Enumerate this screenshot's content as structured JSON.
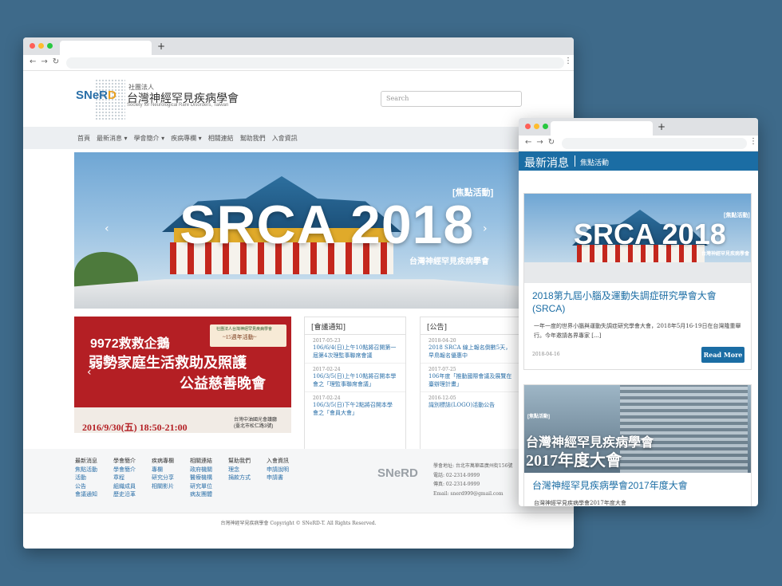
{
  "desktop": {
    "logo": {
      "mark_left": "SNeR",
      "mark_star": "D",
      "sub": "社團法人",
      "name": "台灣神經罕見疾病學會",
      "english": "Society for Neurological Rare Disorders, Taiwan"
    },
    "search_placeholder": "Search",
    "menu": [
      "首頁",
      "最新消息 ▾",
      "學會簡介 ▾",
      "疾病專欄 ▾",
      "相關連結",
      "幫助我們",
      "入會資訊"
    ],
    "banner": {
      "tag": "[焦點活動]",
      "title": "SRCA 2018",
      "subtitle": "台灣神經罕見疾病學會"
    },
    "promo": {
      "line1": "9972救救企鵝",
      "line2": "弱勢家庭生活救助及照護",
      "line3": "公益慈善晚會",
      "badge1": "社團法人台灣神經罕見疾病學會",
      "badge2": "~15週年活動~",
      "date": "2016/9/30(五) 18:50-21:00",
      "venue1": "台灣中油國光會議廳",
      "venue2": "(臺北市松仁路3號)"
    },
    "meetings": {
      "heading": "[會議通知]",
      "items": [
        {
          "date": "2017-05-23",
          "title": "106/6/4(日)上午10點將召開第一屆第4次理監事聯席會議"
        },
        {
          "date": "2017-02-24",
          "title": "106/3/5(日)上午10點將召開本學會之「理監事聯席會議」"
        },
        {
          "date": "2017-02-24",
          "title": "106/3/5(日)下午2點將召開本學會之「會員大會」"
        }
      ]
    },
    "announcements": {
      "heading": "[公告]",
      "items": [
        {
          "date": "2018-04-20",
          "title": "2018 SRCA 線上報名倒數5天，早鳥報名優惠中"
        },
        {
          "date": "2017-07-25",
          "title": "106年度「推動國際會議及展覽在臺辦理計畫」"
        },
        {
          "date": "2016-12-05",
          "title": "識別標誌(LOGO)活動公告"
        }
      ]
    },
    "footer": {
      "columns": [
        {
          "head": "最新消息",
          "links": [
            "焦點活動",
            "活動",
            "公告",
            "會議通知"
          ]
        },
        {
          "head": "學會簡介",
          "links": [
            "學會簡介",
            "章程",
            "組織成員",
            "歷史沿革"
          ]
        },
        {
          "head": "疾病專欄",
          "links": [
            "專欄",
            "研究分享",
            "相關影片"
          ]
        },
        {
          "head": "相關連結",
          "links": [
            "政府機關",
            "醫療機構",
            "研究單位",
            "病友團體"
          ]
        },
        {
          "head": "幫助我們",
          "links": [
            "理念",
            "捐款方式"
          ]
        },
        {
          "head": "入會資訊",
          "links": [
            "申請說明",
            "申請書"
          ]
        }
      ],
      "logo": "SNeRD",
      "address": [
        "學會地址: 台北市萬華區廣州街156號",
        "電話: 02-2314-9999",
        "傳真: 02-2314-9999",
        "Email: snerd999@gmail.com"
      ],
      "copyright": "台灣神經罕見疾病學會 Copyright © SNeRD-T. All Rights Reserved."
    }
  },
  "mobile": {
    "header_title": "最新消息",
    "header_sub": "焦點活動",
    "posts": [
      {
        "img_tag": "[焦點活動]",
        "img_title": "SRCA 2018",
        "img_sub": "台灣神經罕見疾病學會",
        "title": "2018第九屆小腦及運動失調症研究學會大會(SRCA)",
        "excerpt": "一年一度的世界小腦與運動失調症研究學會大會，2018年5月16-19日在台灣隆重舉行。今年邀請各界專家 [...]",
        "date": "2018-04-16",
        "button": "Read More"
      },
      {
        "img_title1": "[焦點活動]",
        "img_title2": "台灣神經罕見疾病學會",
        "img_title3": "2017年度大會",
        "title": "台灣神經罕見疾病學會2017年度大會",
        "excerpt": "台灣神經罕見疾病學會2017年度大會"
      }
    ]
  }
}
